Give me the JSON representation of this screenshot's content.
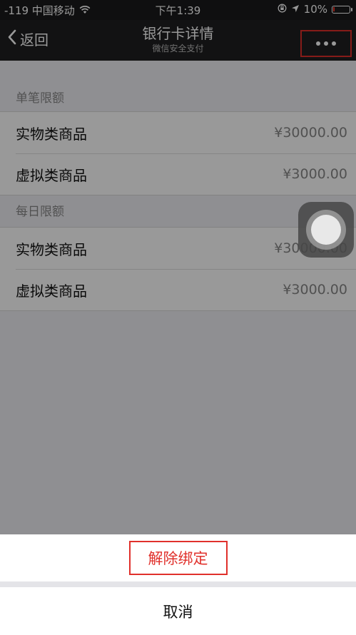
{
  "status_bar": {
    "carrier": "-119 中国移动",
    "time": "下午1:39",
    "battery": "10%",
    "battery_level": 0.1,
    "icons": [
      "wifi-icon",
      "rotation-lock-icon",
      "location-arrow-icon",
      "battery-icon"
    ]
  },
  "nav": {
    "back_label": "返回",
    "title": "银行卡详情",
    "subtitle": "微信安全支付",
    "more_icon": "more-dots-icon"
  },
  "sections": [
    {
      "header": "单笔限额",
      "rows": [
        {
          "label": "实物类商品",
          "value": "¥30000.00"
        },
        {
          "label": "虚拟类商品",
          "value": "¥3000.00"
        }
      ]
    },
    {
      "header": "每日限额",
      "rows": [
        {
          "label": "实物类商品",
          "value": "¥30000.00"
        },
        {
          "label": "虚拟类商品",
          "value": "¥3000.00"
        }
      ]
    }
  ],
  "action_sheet": {
    "unbind_label": "解除绑定",
    "cancel_label": "取消"
  },
  "colors": {
    "highlight_red": "#e0302b",
    "nav_bg": "#1f1f20"
  }
}
